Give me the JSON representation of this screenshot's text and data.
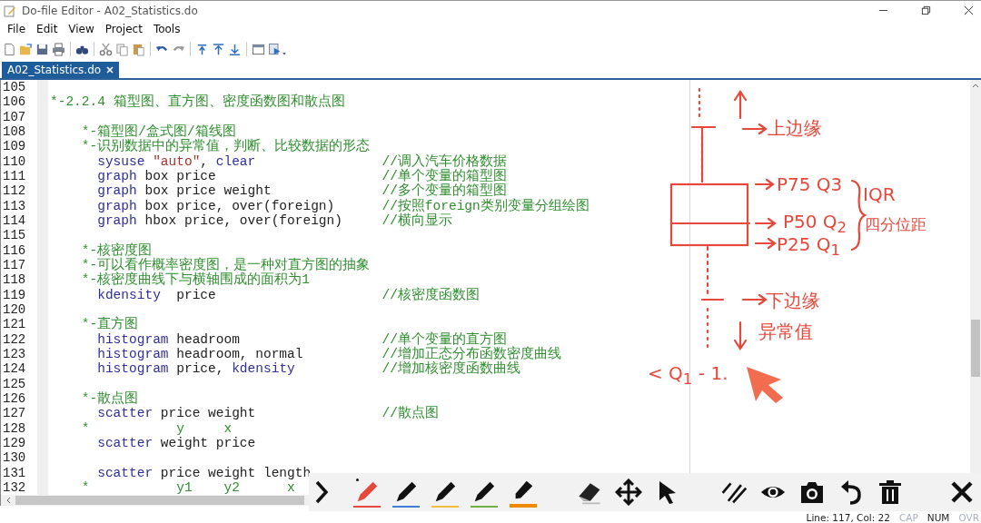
{
  "window": {
    "title": "Do-file Editor - A02_Statistics.do"
  },
  "menu": [
    "File",
    "Edit",
    "View",
    "Project",
    "Tools"
  ],
  "tabs": [
    {
      "label": "A02_Statistics.do",
      "selected": true
    }
  ],
  "editor": {
    "lines": [
      {
        "number": "105"
      },
      {
        "number": "106",
        "tokens": [
          {
            "kind": "comment",
            "text": "*-2.2.4 箱型图、直方图、密度函数图和散点图"
          }
        ]
      },
      {
        "number": "107"
      },
      {
        "number": "108",
        "tokens": [
          {
            "kind": "comment",
            "text": "    *-箱型图/盒式图/箱线图"
          }
        ]
      },
      {
        "number": "109",
        "tokens": [
          {
            "kind": "comment",
            "text": "    *-识别数据中的异常值，判断、比较数据的形态"
          }
        ]
      },
      {
        "number": "110",
        "tokens": [
          {
            "kind": "keyword",
            "text": "      sysuse"
          },
          {
            "kind": "string",
            "text": " \"auto\""
          },
          {
            "kind": "plain",
            "text": ", "
          },
          {
            "kind": "keyword",
            "text": "clear"
          }
        ],
        "comment": "//调入汽车价格数据"
      },
      {
        "number": "111",
        "tokens": [
          {
            "kind": "keyword",
            "text": "      graph"
          },
          {
            "kind": "plain",
            "text": " box price"
          }
        ],
        "comment": "//单个变量的箱型图"
      },
      {
        "number": "112",
        "tokens": [
          {
            "kind": "keyword",
            "text": "      graph"
          },
          {
            "kind": "plain",
            "text": " box price weight"
          }
        ],
        "comment": "//多个变量的箱型图"
      },
      {
        "number": "113",
        "tokens": [
          {
            "kind": "keyword",
            "text": "      graph"
          },
          {
            "kind": "plain",
            "text": " box price, over(foreign)"
          }
        ],
        "comment": "//按照foreign类别变量分组绘图"
      },
      {
        "number": "114",
        "tokens": [
          {
            "kind": "keyword",
            "text": "      graph"
          },
          {
            "kind": "plain",
            "text": " hbox price, over(foreign)"
          }
        ],
        "comment": "//横向显示"
      },
      {
        "number": "115"
      },
      {
        "number": "116",
        "tokens": [
          {
            "kind": "comment",
            "text": "    *-核密度图"
          }
        ]
      },
      {
        "number": "117",
        "tokens": [
          {
            "kind": "comment",
            "text": "    *-可以看作概率密度图，是一种对直方图的抽象"
          }
        ]
      },
      {
        "number": "118",
        "tokens": [
          {
            "kind": "comment",
            "text": "    *-核密度曲线下与横轴围成的面积为1"
          }
        ]
      },
      {
        "number": "119",
        "tokens": [
          {
            "kind": "keyword",
            "text": "      kdensity"
          },
          {
            "kind": "plain",
            "text": "  price"
          }
        ],
        "comment": "//核密度函数图"
      },
      {
        "number": "120"
      },
      {
        "number": "121",
        "tokens": [
          {
            "kind": "comment",
            "text": "    *-直方图"
          }
        ]
      },
      {
        "number": "122",
        "tokens": [
          {
            "kind": "keyword",
            "text": "      histogram"
          },
          {
            "kind": "plain",
            "text": " headroom"
          }
        ],
        "comment": "//单个变量的直方图"
      },
      {
        "number": "123",
        "tokens": [
          {
            "kind": "keyword",
            "text": "      histogram"
          },
          {
            "kind": "plain",
            "text": " headroom, normal"
          }
        ],
        "comment": "//增加正态分布函数密度曲线"
      },
      {
        "number": "124",
        "tokens": [
          {
            "kind": "keyword",
            "text": "      histogram"
          },
          {
            "kind": "plain",
            "text": " price, "
          },
          {
            "kind": "keyword",
            "text": "kdensity"
          }
        ],
        "comment": "//增加核密度函数曲线"
      },
      {
        "number": "125"
      },
      {
        "number": "126",
        "tokens": [
          {
            "kind": "comment",
            "text": "    *-散点图"
          }
        ]
      },
      {
        "number": "127",
        "tokens": [
          {
            "kind": "keyword",
            "text": "      scatter"
          },
          {
            "kind": "plain",
            "text": " price weight"
          }
        ],
        "comment": "//散点图"
      },
      {
        "number": "128",
        "tokens": [
          {
            "kind": "comment",
            "text": "    *           y     x"
          }
        ]
      },
      {
        "number": "129",
        "tokens": [
          {
            "kind": "keyword",
            "text": "      scatter"
          },
          {
            "kind": "plain",
            "text": " weight price"
          }
        ]
      },
      {
        "number": "130"
      },
      {
        "number": "131",
        "tokens": [
          {
            "kind": "keyword",
            "text": "      scatter"
          },
          {
            "kind": "plain",
            "text": " price weight length"
          }
        ]
      },
      {
        "number": "132",
        "tokens": [
          {
            "kind": "comment",
            "text": "    *           y1    y2      x"
          }
        ]
      }
    ]
  },
  "annotations": [
    "上边缘",
    "P75 Q3",
    "P50 Q$_{2}$",
    "P25 Q$_{1}$",
    "IQR",
    "四分位距",
    "下边缘",
    "异常值",
    "< Q$_{1}$ - 1."
  ],
  "pens": [
    {
      "kind": "pen",
      "color": "#e8473b",
      "selected": true
    },
    {
      "kind": "pen",
      "color": "#3b7fd9",
      "selected": false
    },
    {
      "kind": "pen",
      "color": "#f2bd3e",
      "selected": false
    },
    {
      "kind": "pen",
      "color": "#72b043",
      "selected": false
    },
    {
      "kind": "marker",
      "color": "#f08a00",
      "selected": false
    }
  ],
  "status_bar": {
    "position": "Line: 117, Col: 22",
    "indicators": [
      {
        "label": "CAP",
        "on": false
      },
      {
        "label": "NUM",
        "on": true
      },
      {
        "label": "OVR",
        "on": false
      }
    ]
  }
}
